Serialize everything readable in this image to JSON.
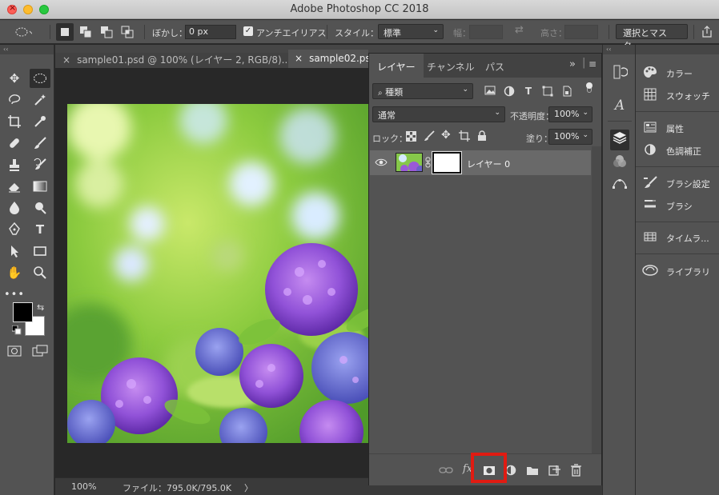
{
  "window": {
    "title": "Adobe Photoshop CC 2018"
  },
  "options_bar": {
    "feather_label": "ぼかし：",
    "feather_value": "0 px",
    "antialias_label": "アンチエイリアス",
    "style_label": "スタイル：",
    "style_value": "標準",
    "width_label": "幅：",
    "height_label": "高さ：",
    "select_mask_button": "選択とマスク..."
  },
  "doc_tabs": [
    {
      "label": "sample01.psd @ 100% (レイヤー 2, RGB/8)...",
      "close": "×"
    },
    {
      "label": "sample02.ps",
      "close": "×"
    }
  ],
  "status_bar": {
    "zoom": "100%",
    "file_info": "ファイル：795.0K/795.0K",
    "arrow": "〉"
  },
  "layers_panel": {
    "tabs": [
      "レイヤー",
      "チャンネル",
      "パス"
    ],
    "filter_value": "種類",
    "blend_mode": "通常",
    "opacity_label": "不透明度：",
    "opacity_value": "100%",
    "lock_label": "ロック：",
    "fill_label": "塗り：",
    "fill_value": "100%",
    "layers": [
      {
        "name": "レイヤー 0"
      }
    ],
    "expand_glyph": "»",
    "menu_glyph": "≡"
  },
  "right_panel": {
    "items": [
      {
        "icon": "palette-icon",
        "label": "カラー"
      },
      {
        "icon": "swatches-icon",
        "label": "スウォッチ"
      },
      {
        "icon": "properties-icon",
        "label": "属性"
      },
      {
        "icon": "adjustments-icon",
        "label": "色調補正"
      },
      {
        "icon": "brush-settings-icon",
        "label": "ブラシ設定"
      },
      {
        "icon": "brush-icon",
        "label": "ブラシ"
      },
      {
        "icon": "timeline-icon",
        "label": "タイムラ..."
      },
      {
        "icon": "libraries-icon",
        "label": "ライブラリ"
      }
    ]
  },
  "colors": {
    "highlight": "#e01b12",
    "foreground": "#000000",
    "background": "#ffffff"
  }
}
